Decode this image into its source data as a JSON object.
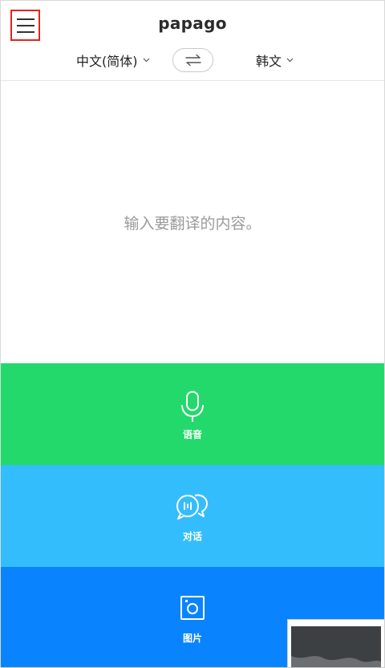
{
  "header": {
    "logo": "papago",
    "menu_icon": "hamburger-menu-icon",
    "source_language": "中文(简体)",
    "target_language": "韩文",
    "swap_icon": "swap-arrows-icon"
  },
  "input": {
    "placeholder": "输入要翻译的内容。"
  },
  "modes": [
    {
      "label": "语音",
      "icon": "microphone-icon",
      "color": "#23d96b"
    },
    {
      "label": "对话",
      "icon": "conversation-bubbles-icon",
      "color": "#34bdfd"
    },
    {
      "label": "图片",
      "icon": "camera-frame-icon",
      "color": "#0a84fe"
    }
  ],
  "colors": {
    "menu_highlight": "#e1261c"
  }
}
